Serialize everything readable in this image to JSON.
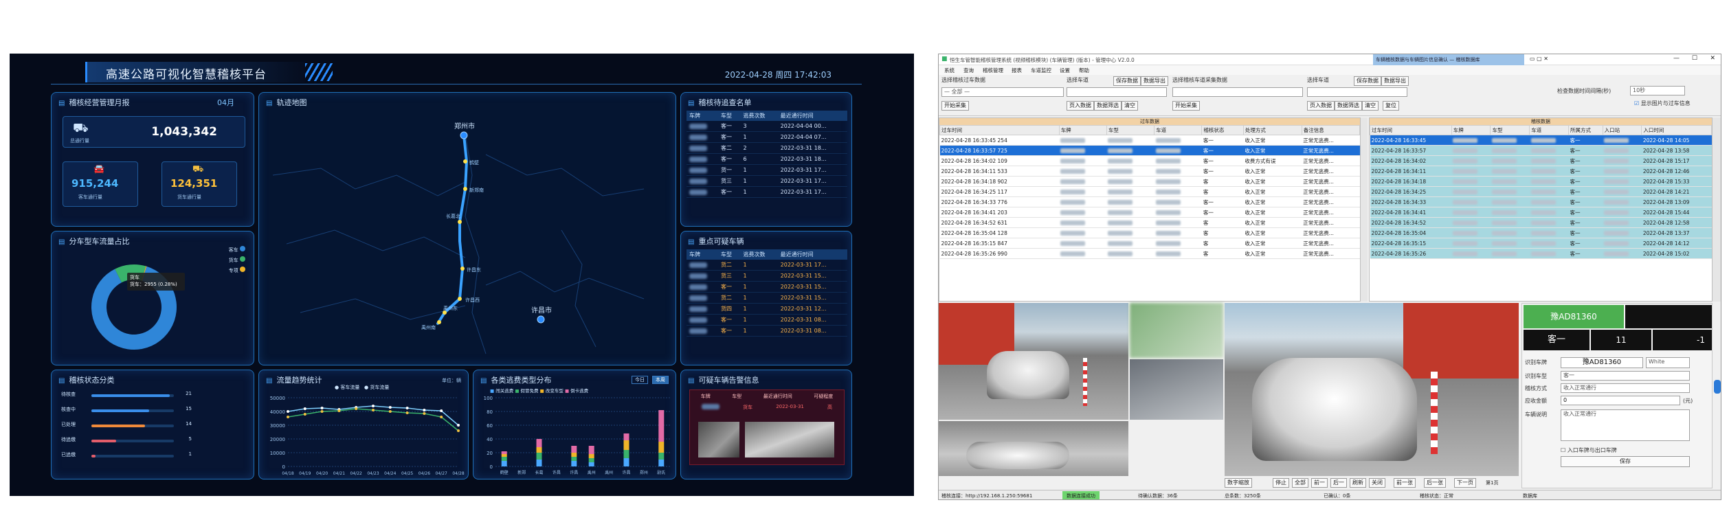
{
  "dashboard": {
    "title": "高速公路可视化智慧稽核平台",
    "datetime": "2022-04-28 周四 17:42:03",
    "monthly": {
      "title": "稽核经营管理月报",
      "month_tag": "04月",
      "total_label": "总通行量",
      "total_value": "1,043,342",
      "sub1_label": "客车通行量",
      "sub1_value": "915,244",
      "sub2_label": "货车通行量",
      "sub2_value": "124,351"
    },
    "ratio": {
      "title": "分车型车流量占比",
      "tooltip_title": "货车",
      "tooltip_text": "货车：2955 (0.28%)",
      "legend": [
        "客车",
        "货车",
        "专项"
      ],
      "colors": [
        "#2f86d8",
        "#3ab36b",
        "#f0b429"
      ]
    },
    "map": {
      "title": "轨迹地图",
      "cities": [
        {
          "name": "郑州市"
        },
        {
          "name": "许昌市"
        }
      ],
      "stations": [
        "鹤壁",
        "新郑南",
        "长葛北",
        "许昌东",
        "许昌西",
        "禹州东",
        "禹州南"
      ]
    },
    "audit_list": {
      "title": "稽核待追查名单",
      "headers": [
        "车牌",
        "车型",
        "逃费次数",
        "最近通行时间"
      ],
      "rows": [
        {
          "type": "客一",
          "count": "3",
          "time": "2022-04-04 00..."
        },
        {
          "type": "客一",
          "count": "1",
          "time": "2022-04-04 07..."
        },
        {
          "type": "客二",
          "count": "2",
          "time": "2022-03-31 18..."
        },
        {
          "type": "客一",
          "count": "6",
          "time": "2022-03-31 18..."
        },
        {
          "type": "货一",
          "count": "1",
          "time": "2022-03-31 17..."
        },
        {
          "type": "货三",
          "count": "1",
          "time": "2022-03-31 17..."
        },
        {
          "type": "客一",
          "count": "1",
          "time": "2022-03-31 17..."
        }
      ]
    },
    "key_vehicles": {
      "title": "重点可疑车辆",
      "headers": [
        "车牌",
        "车型",
        "逃费次数",
        "最近通行时间"
      ],
      "rows": [
        {
          "type": "货二",
          "count": "1",
          "time": "2022-03-31 17..."
        },
        {
          "type": "货三",
          "count": "1",
          "time": "2022-03-31 15..."
        },
        {
          "type": "客一",
          "count": "1",
          "time": "2022-03-31 15..."
        },
        {
          "type": "货二",
          "count": "1",
          "time": "2022-03-31 15..."
        },
        {
          "type": "货四",
          "count": "1",
          "time": "2022-03-31 12..."
        },
        {
          "type": "客一",
          "count": "1",
          "time": "2022-03-31 08..."
        },
        {
          "type": "客一",
          "count": "1",
          "time": "2022-03-31 08..."
        }
      ]
    },
    "status": {
      "title": "稽核状态分类",
      "rows": [
        {
          "label": "待核查",
          "value": "21",
          "pct": 0.95,
          "color": "#3a8eea"
        },
        {
          "label": "核查中",
          "value": "15",
          "pct": 0.7,
          "color": "#3a8eea"
        },
        {
          "label": "已处理",
          "value": "14",
          "pct": 0.65,
          "color": "#f08a3a"
        },
        {
          "label": "待追缴",
          "value": "5",
          "pct": 0.3,
          "color": "#e35d6a"
        },
        {
          "label": "已追缴",
          "value": "1",
          "pct": 0.05,
          "color": "#e35d6a"
        }
      ]
    },
    "traffic": {
      "title": "流量趋势统计",
      "unit": "单位：辆",
      "legend": [
        "客车流量",
        "货车流量"
      ]
    },
    "dist": {
      "title": "各类逃费类型分布",
      "toggle": [
        "今日",
        "本周"
      ],
      "legend": [
        "闯关逃费",
        "假冒免费",
        "改变车型",
        "倒卡逃费"
      ]
    },
    "alert": {
      "title": "可疑车辆告警信息",
      "headers": [
        "车牌",
        "车型",
        "最近通行时间",
        "可疑程度"
      ],
      "row": {
        "type": "货车",
        "time": "2022-03-31",
        "level": "高"
      }
    },
    "chart_data": [
      {
        "type": "pie",
        "title": "分车型车流量占比",
        "labels": [
          "客车",
          "货车",
          "专项"
        ],
        "values": [
          87.8,
          11.9,
          0.3
        ]
      },
      {
        "type": "line",
        "title": "流量趋势统计",
        "x": [
          "04/18",
          "04/19",
          "04/20",
          "04/21",
          "04/22",
          "04/23",
          "04/24",
          "04/25",
          "04/26",
          "04/27",
          "04/28"
        ],
        "ylim": [
          0,
          50000
        ],
        "yticks": [
          "0",
          "10000",
          "20000",
          "30000",
          "40000",
          "50000"
        ],
        "series": [
          {
            "name": "客车流量",
            "values": [
              40000,
              42000,
              42500,
              41500,
              43000,
              44000,
              43000,
              42500,
              41000,
              40500,
              30000
            ]
          },
          {
            "name": "货车流量",
            "values": [
              36000,
              38000,
              40000,
              40500,
              42000,
              41000,
              40000,
              39000,
              38500,
              36000,
              26000
            ]
          }
        ]
      },
      {
        "type": "bar",
        "title": "各类逃费类型分布",
        "categories": [
          "鹤壁",
          "新郑南",
          "长葛北",
          "许昌东",
          "许昌西",
          "禹州东",
          "禹州南",
          "许昌",
          "郑州",
          "尉氏"
        ],
        "ylim": [
          0,
          100
        ],
        "yticks": [
          "0",
          "20",
          "40",
          "60",
          "80",
          "100"
        ],
        "series": [
          {
            "name": "闯关逃费",
            "values": [
              8,
              0,
              10,
              0,
              8,
              6,
              0,
              12,
              0,
              10
            ]
          },
          {
            "name": "假冒免费",
            "values": [
              6,
              0,
              10,
              0,
              6,
              6,
              0,
              12,
              0,
              10
            ]
          },
          {
            "name": "改变车型",
            "values": [
              4,
              0,
              8,
              0,
              6,
              6,
              0,
              14,
              0,
              16
            ]
          },
          {
            "name": "倒卡逃费",
            "values": [
              4,
              0,
              12,
              0,
              10,
              12,
              0,
              10,
              0,
              46
            ]
          }
        ]
      }
    ]
  },
  "app": {
    "title": "恒生车管智能稽核管理系统 (视频稽核模块) (车辆管理) (版本) - 管理中心 V2.0.0",
    "popup_title": "车辆稽核数据与车辆图片信息确认 — 稽核数据库",
    "menu": [
      "系统",
      "查询",
      "稽核管理",
      "报表",
      "车道监控",
      "设置",
      "帮助"
    ],
    "sections": {
      "s1": {
        "label": "选择稽核过车数据",
        "select": "— 全部 —",
        "btn1": "开始采集"
      },
      "s2": {
        "label": "选择车道",
        "btn1": "保存数据",
        "btn2": "数据导出",
        "btn3": "页入数据",
        "btn4": "数据筛选",
        "btn5": "清空"
      },
      "s3": {
        "label": "选择稽核车道采集数据",
        "btn1": "开始采集"
      },
      "s4": {
        "label": "选择车道",
        "btn1": "保存数据",
        "btn2": "数据导出",
        "btn3": "页入数据",
        "btn4": "数据筛选",
        "btn5": "清空",
        "btn6": "复位"
      },
      "right_label": "检查数据时间间隔(秒)",
      "right_value": "10秒",
      "right_check": "显示图片与过车信息"
    },
    "left_grid": {
      "title": "过车数据",
      "headers": [
        "过车时间",
        "车牌",
        "车型",
        "车道",
        "稽核状态",
        "处理方式",
        "备注信息"
      ],
      "rows": [
        {
          "t": "2022-04-28 16:33:45 254",
          "type": "客一",
          "status": "收入正常",
          "note": "正常无逃费..."
        },
        {
          "t": "2022-04-28 16:33:57 725",
          "type": "客一",
          "status": "收入正常",
          "note": "正常无逃费..."
        },
        {
          "t": "2022-04-28 16:34:02 109",
          "type": "客一",
          "status": "收费方式有误",
          "note": "正常无逃费..."
        },
        {
          "t": "2022-04-28 16:34:11 533",
          "type": "客一",
          "status": "收入正常",
          "note": "正常无逃费..."
        },
        {
          "t": "2022-04-28 16:34:18 902",
          "type": "客",
          "status": "收入正常",
          "note": "正常无逃费..."
        },
        {
          "t": "2022-04-28 16:34:25 117",
          "type": "客",
          "status": "收入正常",
          "note": "正常无逃费..."
        },
        {
          "t": "2022-04-28 16:34:33 776",
          "type": "客一",
          "status": "收入正常",
          "note": "正常无逃费..."
        },
        {
          "t": "2022-04-28 16:34:41 203",
          "type": "客一",
          "status": "收入正常",
          "note": "正常无逃费..."
        },
        {
          "t": "2022-04-28 16:34:52 631",
          "type": "客",
          "status": "收入正常",
          "note": "正常无逃费..."
        },
        {
          "t": "2022-04-28 16:35:04 128",
          "type": "客",
          "status": "收入正常",
          "note": "正常无逃费..."
        },
        {
          "t": "2022-04-28 16:35:15 847",
          "type": "客",
          "status": "收入正常",
          "note": "正常无逃费..."
        },
        {
          "t": "2022-04-28 16:35:26 990",
          "type": "客",
          "status": "收入正常",
          "note": "正常无逃费..."
        }
      ]
    },
    "right_grid": {
      "title": "稽核数据",
      "headers": [
        "过车时间",
        "车牌",
        "车型",
        "车道",
        "所属方式",
        "入口站",
        "入口时间"
      ],
      "rows": [
        {
          "t": "2022-04-28 16:33:45",
          "type": "客一",
          "time": "2022-04-28 14:05"
        },
        {
          "t": "2022-04-28 16:33:57",
          "type": "客一",
          "time": "2022-04-28 13:58"
        },
        {
          "t": "2022-04-28 16:34:02",
          "type": "客一",
          "time": "2022-04-28 15:17"
        },
        {
          "t": "2022-04-28 16:34:11",
          "type": "客一",
          "time": "2022-04-28 12:46"
        },
        {
          "t": "2022-04-28 16:34:18",
          "type": "客一",
          "time": "2022-04-28 15:33"
        },
        {
          "t": "2022-04-28 16:34:25",
          "type": "客一",
          "time": "2022-04-28 14:21"
        },
        {
          "t": "2022-04-28 16:34:33",
          "type": "客一",
          "time": "2022-04-28 13:09"
        },
        {
          "t": "2022-04-28 16:34:41",
          "type": "客一",
          "time": "2022-04-28 15:44"
        },
        {
          "t": "2022-04-28 16:34:52",
          "type": "客一",
          "time": "2022-04-28 12:58"
        },
        {
          "t": "2022-04-28 16:35:04",
          "type": "客一",
          "time": "2022-04-28 13:37"
        },
        {
          "t": "2022-04-28 16:35:15",
          "type": "客一",
          "time": "2022-04-28 14:12"
        },
        {
          "t": "2022-04-28 16:35:26",
          "type": "客一",
          "time": "2022-04-28 15:02"
        }
      ]
    },
    "detail": {
      "plate_green": "豫AD81360",
      "type_label": "客一",
      "axle_value": "11",
      "minus": "-1",
      "f1_label": "识别车牌",
      "f1_value": "豫AD81360",
      "f1_sel": "White",
      "f2_label": "识别车型",
      "f2_value": "客一",
      "f3_label": "稽核方式",
      "f3_value": "收入正常通行",
      "f4_label": "应收金额",
      "f4_value": "0",
      "f4_unit": "(元)",
      "f5_label": "车辆说明",
      "f5_value": "收入正常通行",
      "check": "入口车牌与出口车牌",
      "save": "保存"
    },
    "video_controls": [
      "停止",
      "全部",
      "前一",
      "后一",
      "刷新",
      "关闭",
      "前一张",
      "后一张",
      "下一页"
    ],
    "video_left": "数字缩放",
    "video_page": "第1页",
    "status_bar": [
      "稽核连接：http://192.168.1.250:59681",
      "数据连接成功",
      "待确认数据：36条",
      "总条数：3250条",
      "已确认：0条",
      "稽核状态：正常",
      "数据库"
    ]
  }
}
